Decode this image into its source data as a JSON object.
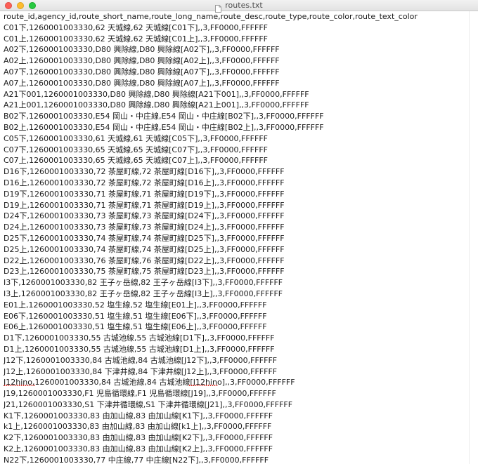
{
  "window": {
    "title": "routes.txt"
  },
  "document": {
    "lines": [
      "route_id,agency_id,route_short_name,route_long_name,route_desc,route_type,route_color,route_text_color",
      "C01下,1260001003330,62 天城線,62 天城線[C01下],,3,FF0000,FFFFFF",
      "C01上,1260001003330,62 天城線,62 天城線[C01上],,3,FF0000,FFFFFF",
      "A02下,1260001003330,D80 興除線,D80 興除線[A02下],,3,FF0000,FFFFFF",
      "A02上,1260001003330,D80 興除線,D80 興除線[A02上],,3,FF0000,FFFFFF",
      "A07下,1260001003330,D80 興除線,D80 興除線[A07下],,3,FF0000,FFFFFF",
      "A07上,1260001003330,D80 興除線,D80 興除線[A07上],,3,FF0000,FFFFFF",
      "A21下001,1260001003330,D80 興除線,D80 興除線[A21下001],,3,FF0000,FFFFFF",
      "A21上001,1260001003330,D80 興除線,D80 興除線[A21上001],,3,FF0000,FFFFFF",
      "B02下,1260001003330,E54 岡山・中庄線,E54 岡山・中庄線[B02下],,3,FF0000,FFFFFF",
      "B02上,1260001003330,E54 岡山・中庄線,E54 岡山・中庄線[B02上],,3,FF0000,FFFFFF",
      "C05下,1260001003330,61 天城線,61 天城線[C05下],,3,FF0000,FFFFFF",
      "C07下,1260001003330,65 天城線,65 天城線[C07下],,3,FF0000,FFFFFF",
      "C07上,1260001003330,65 天城線,65 天城線[C07上],,3,FF0000,FFFFFF",
      "D16下,1260001003330,72 茶屋町線,72 茶屋町線[D16下],,3,FF0000,FFFFFF",
      "D16上,1260001003330,72 茶屋町線,72 茶屋町線[D16上],,3,FF0000,FFFFFF",
      "D19下,1260001003330,71 茶屋町線,71 茶屋町線[D19下],,3,FF0000,FFFFFF",
      "D19上,1260001003330,71 茶屋町線,71 茶屋町線[D19上],,3,FF0000,FFFFFF",
      "D24下,1260001003330,73 茶屋町線,73 茶屋町線[D24下],,3,FF0000,FFFFFF",
      "D24上,1260001003330,73 茶屋町線,73 茶屋町線[D24上],,3,FF0000,FFFFFF",
      "D25下,1260001003330,74 茶屋町線,74 茶屋町線[D25下],,3,FF0000,FFFFFF",
      "D25上,1260001003330,74 茶屋町線,74 茶屋町線[D25上],,3,FF0000,FFFFFF",
      "D22上,1260001003330,76 茶屋町線,76 茶屋町線[D22上],,3,FF0000,FFFFFF",
      "D23上,1260001003330,75 茶屋町線,75 茶屋町線[D23上],,3,FF0000,FFFFFF",
      "I3下,1260001003330,82 王子ヶ岳線,82 王子ヶ岳線[I3下],,3,FF0000,FFFFFF",
      "I3上,1260001003330,82 王子ヶ岳線,82 王子ヶ岳線[I3上],,3,FF0000,FFFFFF",
      "E01上,1260001003330,52 塩生線,52 塩生線[E01上],,3,FF0000,FFFFFF",
      "E06下,1260001003330,51 塩生線,51 塩生線[E06下],,3,FF0000,FFFFFF",
      "E06上,1260001003330,51 塩生線,51 塩生線[E06上],,3,FF0000,FFFFFF",
      "D1下,1260001003330,55 古城池線,55 古城池線[D1下],,3,FF0000,FFFFFF",
      "D1上,1260001003330,55 古城池線,55 古城池線[D1上],,3,FF0000,FFFFFF",
      "J12下,1260001003330,84 古城池線,84 古城池線[J12下],,3,FF0000,FFFFFF",
      "J12上,1260001003330,84 下津井線,84 下津井線[J12上],,3,FF0000,FFFFFF",
      "J12hino,1260001003330,84 古城池線,84 古城池線[J12hino],,3,FF0000,FFFFFF",
      "J19,1260001003330,F1 児島循環線,F1 児島循環線[J19],,3,FF0000,FFFFFF",
      "J21,1260001003330,S1 下津井循環線,S1 下津井循環線[J21],,3,FF0000,FFFFFF",
      "K1下,1260001003330,83 由加山線,83 由加山線[K1下],,3,FF0000,FFFFFF",
      "k1上,1260001003330,83 由加山線,83 由加山線[k1上],,3,FF0000,FFFFFF",
      "K2下,1260001003330,83 由加山線,83 由加山線[K2下],,3,FF0000,FFFFFF",
      "K2上,1260001003330,83 由加山線,83 由加山線[K2上],,3,FF0000,FFFFFF",
      "N22下,1260001003330,77 中庄線,77 中庄線[N22下],,3,FF0000,FFFFFF"
    ]
  },
  "colors": {
    "text": "#1a1a1a",
    "spellcheck": "#e0352b"
  }
}
